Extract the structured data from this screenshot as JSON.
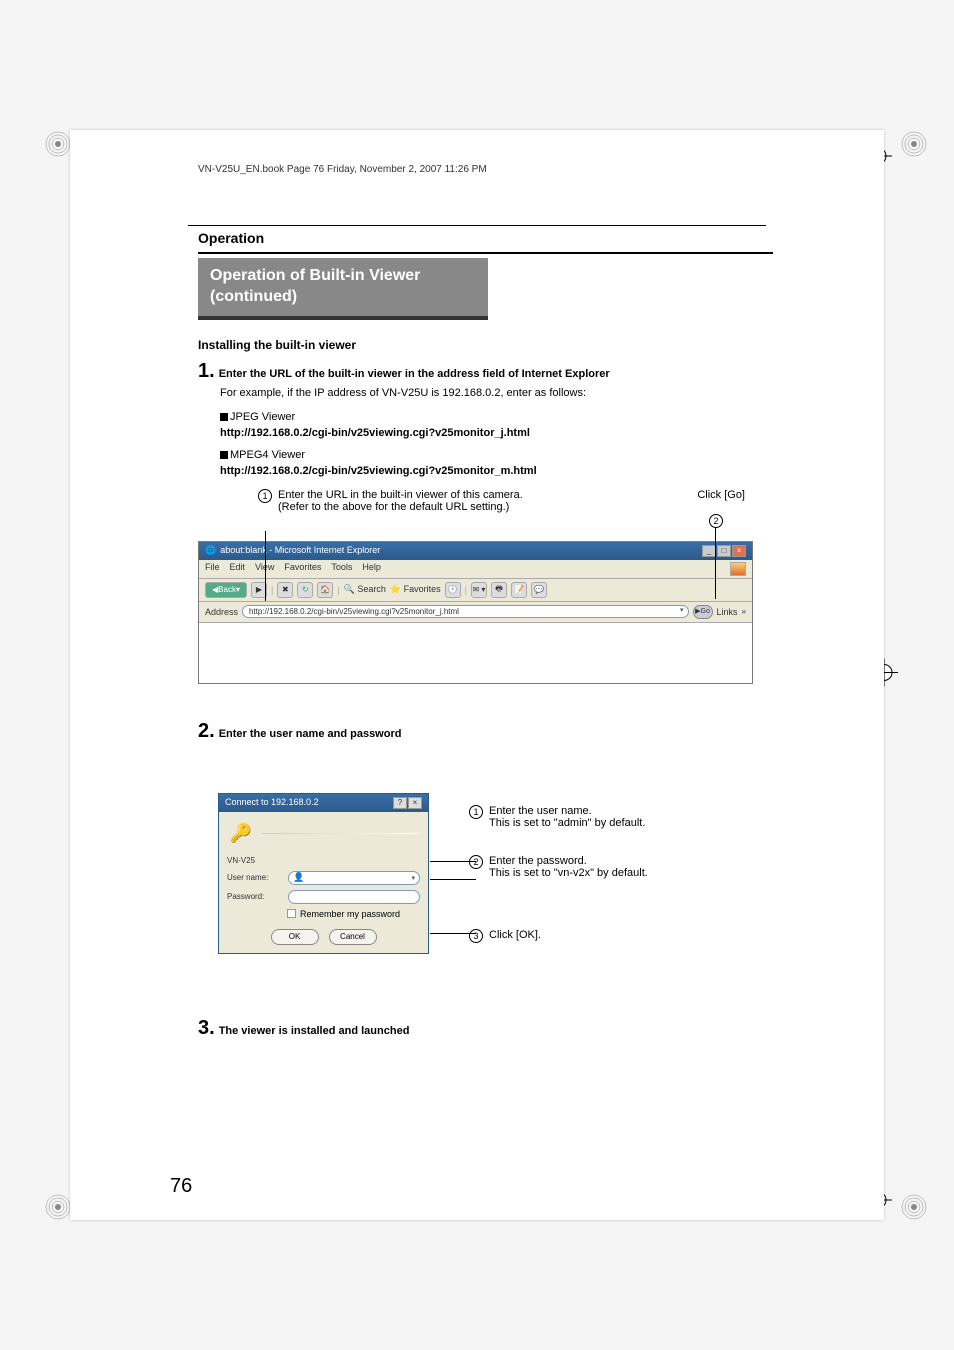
{
  "doc_header": "VN-V25U_EN.book  Page 76  Friday, November 2, 2007  11:26 PM",
  "section_title": "Operation",
  "box_title": "Operation of Built-in Viewer (continued)",
  "subhead": "Installing the built-in viewer",
  "step1": {
    "num": "1.",
    "body": "Enter the URL of the built-in viewer in the address field of Internet Explorer",
    "note": "For example, if the IP address of VN-V25U is 192.168.0.2, enter as follows:"
  },
  "jpeg_viewer": {
    "label": "JPEG Viewer",
    "url": "http://192.168.0.2/cgi-bin/v25viewing.cgi?v25monitor_j.html"
  },
  "mpeg4_viewer": {
    "label": "MPEG4 Viewer",
    "url": "http://192.168.0.2/cgi-bin/v25viewing.cgi?v25monitor_m.html"
  },
  "callout1": {
    "num": "1",
    "line1": "Enter the URL in the built-in viewer of this camera.",
    "line2": "(Refer to the above for the default URL setting.)"
  },
  "click_go": "Click [Go]",
  "callout_go_num": "2",
  "ie_window": {
    "title": "about:blank - Microsoft Internet Explorer",
    "menu": [
      "File",
      "Edit",
      "View",
      "Favorites",
      "Tools",
      "Help"
    ],
    "toolbar": {
      "back": "Back",
      "search": "Search",
      "favorites": "Favorites"
    },
    "address_label": "Address",
    "address_value": "http://192.168.0.2/cgi-bin/v25viewing.cgi?v25monitor_j.html",
    "go": "Go",
    "links": "Links"
  },
  "step2": {
    "num": "2.",
    "body": "Enter the user name and password"
  },
  "login_dialog": {
    "title": "Connect to 192.168.0.2",
    "server": "VN-V25",
    "username_label": "User name:",
    "password_label": "Password:",
    "remember": "Remember my password",
    "ok": "OK",
    "cancel": "Cancel"
  },
  "annot1": {
    "num": "1",
    "line1": "Enter the user name.",
    "line2": "This is set to \"admin\" by default."
  },
  "annot2": {
    "num": "2",
    "line1": "Enter the password.",
    "line2": "This is set to \"vn-v2x\" by default."
  },
  "annot3": {
    "num": "3",
    "text": "Click [OK]."
  },
  "step3": {
    "num": "3.",
    "body": "The viewer is installed and launched"
  },
  "page_number": "76"
}
